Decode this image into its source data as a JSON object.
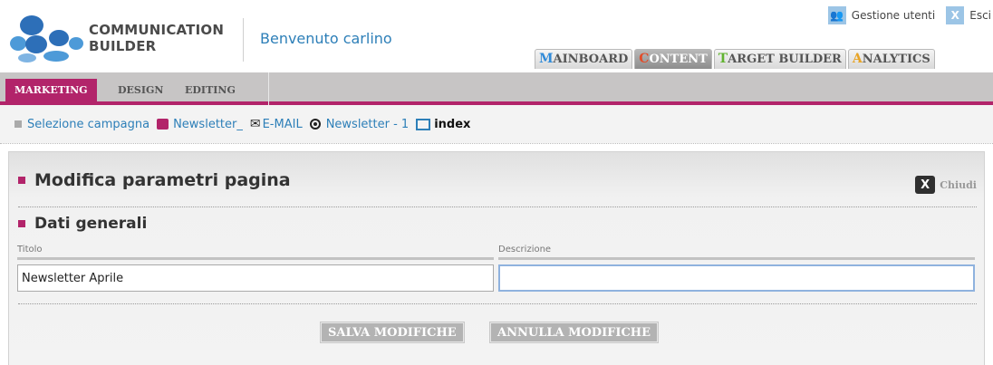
{
  "app": {
    "logo_line1": "COMMUNICATION",
    "logo_line2": "BUILDER",
    "welcome": "Benvenuto carlino"
  },
  "top_links": {
    "users_label": "Gestione utenti",
    "exit_label": "Esci"
  },
  "main_tabs": [
    {
      "first": "M",
      "rest": "AINBOARD",
      "active": false,
      "accent": "#2f8ad8"
    },
    {
      "first": "C",
      "rest": "ONTENT",
      "active": true,
      "accent": "#e24d2a"
    },
    {
      "first": "T",
      "rest": "ARGET BUILDER",
      "active": false,
      "accent": "#61b330"
    },
    {
      "first": "A",
      "rest": "NALYTICS",
      "active": false,
      "accent": "#e8a323"
    }
  ],
  "sub_tabs": [
    {
      "label": "MARKETING",
      "active": true
    },
    {
      "label": "DESIGN",
      "active": false
    },
    {
      "label": "EDITING",
      "active": false
    }
  ],
  "breadcrumb": {
    "campaign": "Selezione campagna",
    "newsletter": "Newsletter_",
    "channel": "E-MAIL",
    "item": "Newsletter - 1",
    "page": "index"
  },
  "panel": {
    "title": "Modifica parametri pagina",
    "close_label": "Chiudi",
    "section_title": "Dati generali",
    "fields": {
      "title_label": "Titolo",
      "title_value": "Newsletter Aprile",
      "desc_label": "Descrizione",
      "desc_value": ""
    },
    "save_label": "SALVA MODIFICHE",
    "cancel_label": "ANNULLA MODIFICHE"
  },
  "colors": {
    "brand": "#b2246a",
    "link": "#2d7fb8"
  }
}
